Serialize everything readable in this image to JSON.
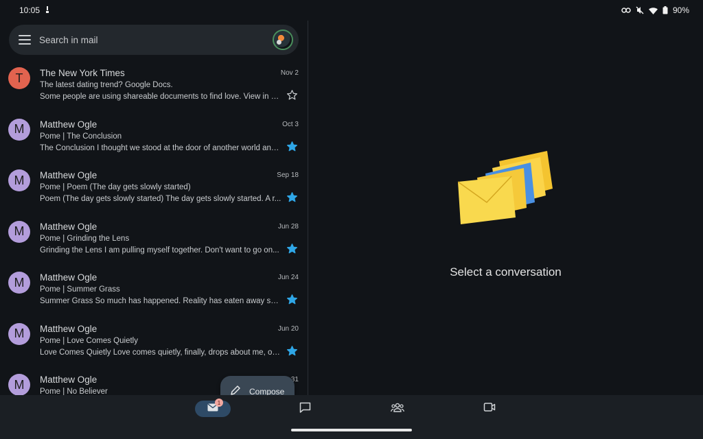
{
  "status_bar": {
    "time": "10:05",
    "battery": "90%"
  },
  "search": {
    "placeholder": "Search in mail"
  },
  "emails": [
    {
      "initial": "T",
      "avatar_color": "#e2634f",
      "sender": "The New York Times",
      "date": "Nov 2",
      "subject": "The latest dating trend? Google Docs.",
      "snippet": "Some people are using shareable documents to find love. View in br...",
      "starred": false
    },
    {
      "initial": "M",
      "avatar_color": "#b39ddb",
      "sender": "Matthew Ogle",
      "date": "Oct 3",
      "subject": "Pome | The Conclusion",
      "snippet": "The Conclusion I thought we stood at the door of another world and...",
      "starred": true
    },
    {
      "initial": "M",
      "avatar_color": "#b39ddb",
      "sender": "Matthew Ogle",
      "date": "Sep 18",
      "subject": "Pome | Poem (The day gets slowly started)",
      "snippet": "Poem (The day gets slowly started) The day gets slowly started. A r...",
      "starred": true
    },
    {
      "initial": "M",
      "avatar_color": "#b39ddb",
      "sender": "Matthew Ogle",
      "date": "Jun 28",
      "subject": "Pome | Grinding the Lens",
      "snippet": "Grinding the Lens I am pulling myself together. Don't want to go on...",
      "starred": true
    },
    {
      "initial": "M",
      "avatar_color": "#b39ddb",
      "sender": "Matthew Ogle",
      "date": "Jun 24",
      "subject": "Pome | Summer Grass",
      "snippet": "Summer Grass So much has happened. Reality has eaten away so...",
      "starred": true
    },
    {
      "initial": "M",
      "avatar_color": "#b39ddb",
      "sender": "Matthew Ogle",
      "date": "Jun 20",
      "subject": "Pome | Love Comes Quietly",
      "snippet": "Love Comes Quietly Love comes quietly, finally, drops about me, on...",
      "starred": true
    },
    {
      "initial": "M",
      "avatar_color": "#b39ddb",
      "sender": "Matthew Ogle",
      "date": "31",
      "subject": "Pome | No Believer",
      "snippet": "",
      "starred": true
    }
  ],
  "compose": {
    "label": "Compose"
  },
  "detail": {
    "empty_message": "Select a conversation"
  },
  "bottom_nav": {
    "mail_badge": "1",
    "items": [
      {
        "icon": "mail-icon"
      },
      {
        "icon": "chat-icon"
      },
      {
        "icon": "spaces-icon"
      },
      {
        "icon": "meet-icon"
      }
    ]
  },
  "colors": {
    "star_filled": "#2fa6e6",
    "star_outline": "#c5c8cb",
    "nav_active_bg": "#2e4a66"
  }
}
